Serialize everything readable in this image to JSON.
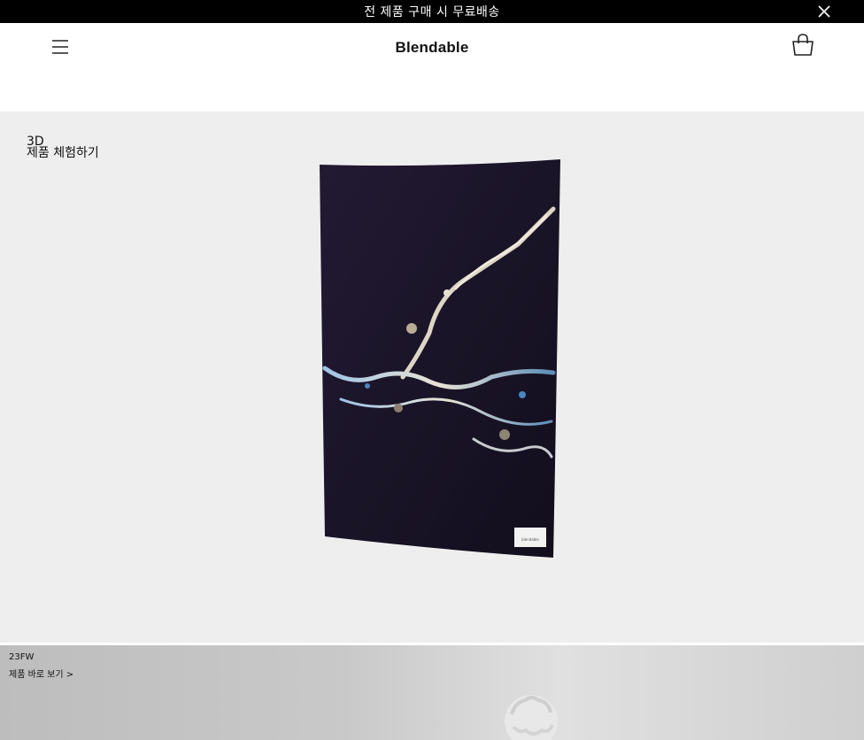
{
  "announcement": {
    "text": "전 제품 구매 시 무료배송"
  },
  "header": {
    "logo": "Blendable"
  },
  "viewer": {
    "label_line1": "3D",
    "label_line2": "제품 체험하기",
    "product_tag": "blendable"
  },
  "promo": {
    "season": "23FW",
    "link_text": "제품 바로 보기 >"
  },
  "colors": {
    "announcement_bg": "#000000",
    "viewer_bg": "#eeeeee",
    "fabric": "#1a1428"
  },
  "icons": [
    "close-icon",
    "menu-icon",
    "shopping-bag-icon"
  ]
}
